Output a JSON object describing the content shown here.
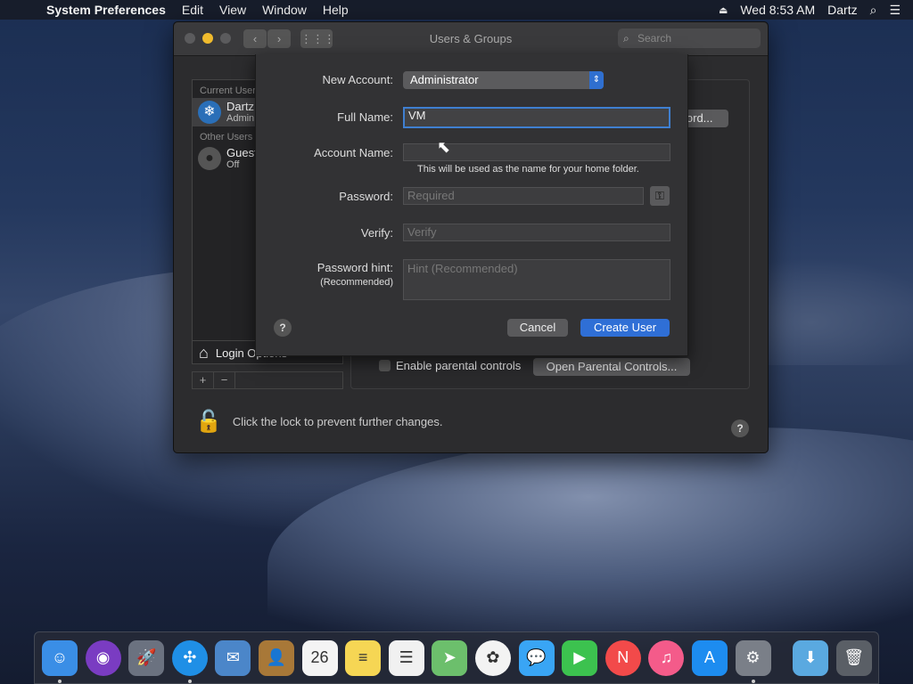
{
  "menubar": {
    "app_name": "System Preferences",
    "menus": [
      "Edit",
      "View",
      "Window",
      "Help"
    ],
    "clock": "Wed 8:53 AM",
    "user": "Dartz"
  },
  "window": {
    "title": "Users & Groups",
    "search_placeholder": "Search"
  },
  "userlist": {
    "current_header": "Current Users",
    "current_user_name": "Dartz",
    "current_user_role": "Admin",
    "other_header": "Other Users",
    "guest_name": "Guest User",
    "guest_status": "Off",
    "login_options": "Login Options"
  },
  "panel": {
    "change_password_btn": "Change Password...",
    "parental_checkbox": "Enable parental controls",
    "parental_btn": "Open Parental Controls..."
  },
  "lock": {
    "text": "Click the lock to prevent further changes."
  },
  "sheet": {
    "new_account_label": "New Account:",
    "new_account_value": "Administrator",
    "full_name_label": "Full Name:",
    "full_name_value": "VM",
    "account_name_label": "Account Name:",
    "account_name_value": "",
    "account_name_note": "This will be used as the name for your home folder.",
    "password_label": "Password:",
    "password_placeholder": "Required",
    "verify_label": "Verify:",
    "verify_placeholder": "Verify",
    "hint_label": "Password hint:",
    "hint_label_sub": "(Recommended)",
    "hint_placeholder": "Hint (Recommended)",
    "help": "?",
    "cancel": "Cancel",
    "create": "Create User"
  },
  "dock": {
    "apps": [
      {
        "icon": "finder-icon",
        "color": "#3a8ee6",
        "glyph": "☺",
        "running": true
      },
      {
        "icon": "siri-icon",
        "color": "#7a3cc2",
        "glyph": "◉",
        "running": false
      },
      {
        "icon": "launchpad-icon",
        "color": "#6b7280",
        "glyph": "🚀",
        "running": false
      },
      {
        "icon": "safari-icon",
        "color": "#1f8fe6",
        "glyph": "✣",
        "running": true
      },
      {
        "icon": "mail-icon",
        "color": "#4b86c9",
        "glyph": "✉",
        "running": false
      },
      {
        "icon": "contacts-icon",
        "color": "#a87838",
        "glyph": "👤",
        "running": false
      },
      {
        "icon": "calendar-icon",
        "color": "#f4f4f4",
        "glyph": "26",
        "running": false
      },
      {
        "icon": "notes-icon",
        "color": "#f6d654",
        "glyph": "≡",
        "running": false
      },
      {
        "icon": "reminders-icon",
        "color": "#f1f1f1",
        "glyph": "☰",
        "running": false
      },
      {
        "icon": "maps-icon",
        "color": "#6cbf6c",
        "glyph": "➤",
        "running": false
      },
      {
        "icon": "photos-icon",
        "color": "#f3f3f3",
        "glyph": "✿",
        "running": false
      },
      {
        "icon": "messages-icon",
        "color": "#39a5f5",
        "glyph": "💬",
        "running": false
      },
      {
        "icon": "facetime-icon",
        "color": "#3cc24f",
        "glyph": "▶",
        "running": false
      },
      {
        "icon": "news-icon",
        "color": "#f24a4a",
        "glyph": "N",
        "running": false
      },
      {
        "icon": "itunes-icon",
        "color": "#f45b8a",
        "glyph": "♫",
        "running": false
      },
      {
        "icon": "app-store-icon",
        "color": "#1d8cf0",
        "glyph": "A",
        "running": false
      },
      {
        "icon": "system-preferences-icon",
        "color": "#7a7f88",
        "glyph": "⚙",
        "running": true
      }
    ],
    "extras": [
      {
        "icon": "downloads-folder-icon",
        "color": "#5aa9e0",
        "glyph": "⬇"
      },
      {
        "icon": "trash-icon",
        "color": "#5a5f66",
        "glyph": "🗑"
      }
    ]
  }
}
